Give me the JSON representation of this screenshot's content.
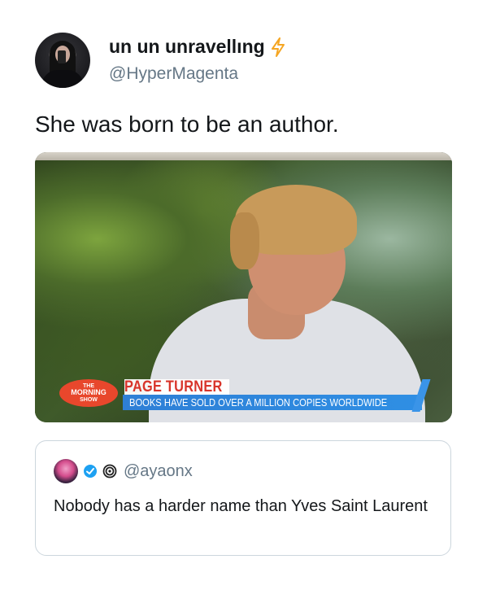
{
  "tweet": {
    "display_name": "un un unravellıng",
    "handle": "@HyperMagenta",
    "text": "She was born to be an author.",
    "icons": {
      "badge": "lightning-bolt-icon",
      "avatar": "user-avatar"
    },
    "colors": {
      "bolt": "#f5a623",
      "handle": "#657786",
      "text": "#14171a"
    }
  },
  "media": {
    "logo_line1": "THE",
    "logo_line2": "MORNING",
    "logo_line3": "SHOW",
    "headline": "PAGE TURNER",
    "subline": "BOOKS HAVE SOLD OVER A MILLION COPIES WORLDWIDE",
    "colors": {
      "headline": "#d8342a",
      "subline_bg": "#2f8fe4",
      "logo_bg": "#e8472c"
    }
  },
  "quote": {
    "handle": "@ayaonx",
    "text": "Nobody has a harder name than Yves Saint Laurent",
    "icons": [
      "verified-check-icon",
      "spiral-icon"
    ]
  }
}
